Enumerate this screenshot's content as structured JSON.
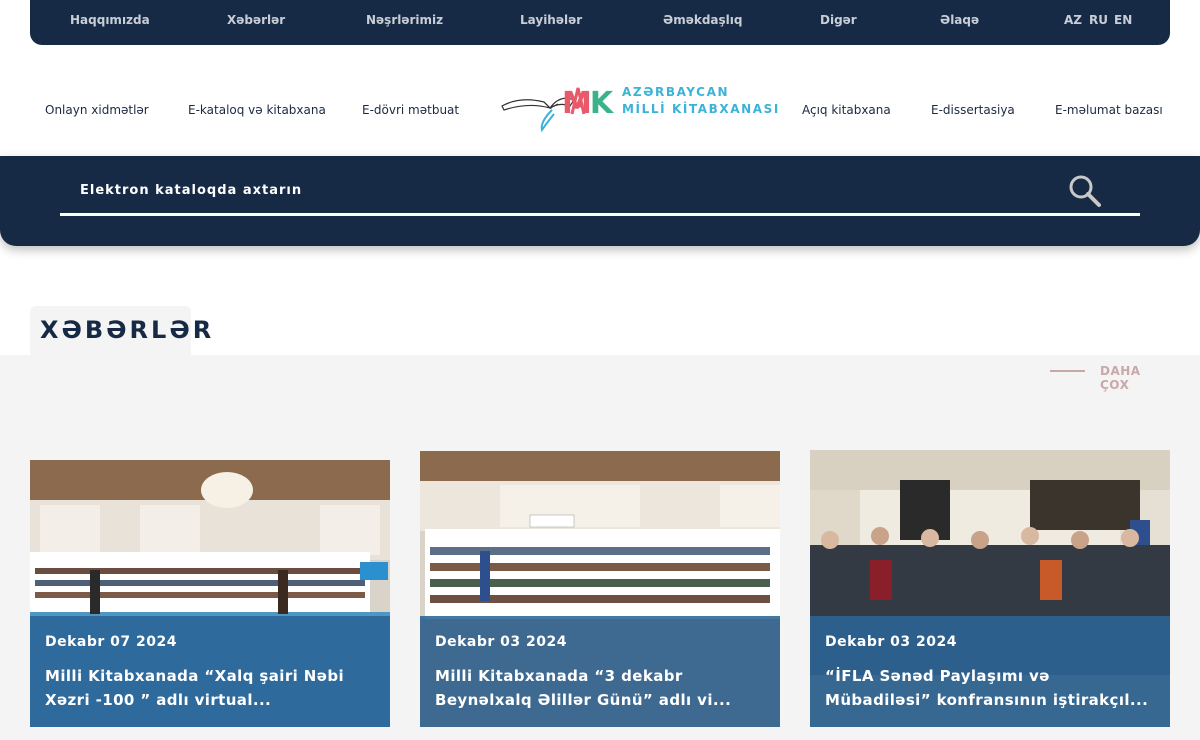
{
  "top_nav": {
    "items": [
      "Haqqımızda",
      "Xəbərlər",
      "Nəşrlərimiz",
      "Layihələr",
      "Əməkdaşlıq",
      "Digər",
      "Əlaqə"
    ],
    "languages": [
      "AZ",
      "RU",
      "EN"
    ]
  },
  "sub_nav": {
    "left": [
      "Onlayn xidmətlər",
      "E-kataloq və kitabxana",
      "E-dövri mətbuat"
    ],
    "right": [
      "Açıq kitabxana",
      "E-dissertasiya",
      "E-məlumat bazası"
    ]
  },
  "logo": {
    "line1": "AZƏRBAYCAN",
    "line2": "MİLLİ KİTABXANASI",
    "mark": "MK"
  },
  "search": {
    "placeholder": "Elektron kataloqda axtarın"
  },
  "news": {
    "heading": "XƏBƏRLƏR",
    "more_label": "DAHA ÇOX",
    "cards": [
      {
        "date": "Dekabr 07 2024",
        "title": "Milli Kitabxanada “Xalq şairi Nəbi Xəzri -100 ” adlı virtual..."
      },
      {
        "date": "Dekabr 03 2024",
        "title": "Milli Kitabxanada “3 dekabr Beynəlxalq Əlillər Günü” adlı vi..."
      },
      {
        "date": "Dekabr 03 2024",
        "title": "“İFLA Sənəd Paylaşımı və Mübadiləsi” konfransının iştirakçıl..."
      }
    ]
  },
  "colors": {
    "navy": "#172a45",
    "accent_blue": "#3bb3d9",
    "card_overlay": "#2b6496",
    "muted_pink": "#c8a8a8"
  }
}
